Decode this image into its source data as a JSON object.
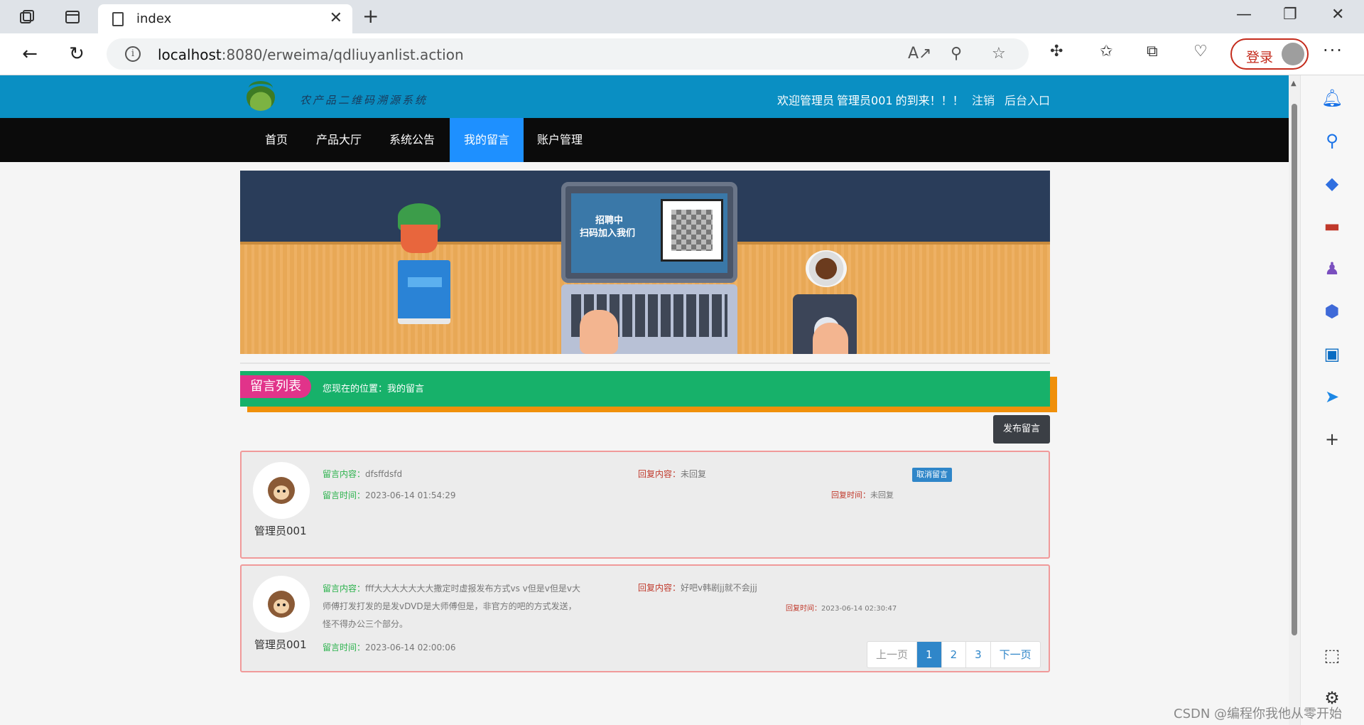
{
  "browser": {
    "tab_title": "index",
    "url_host": "localhost",
    "url_path": ":8080/erweima/qdliuyanlist.action",
    "login_label": "登录"
  },
  "site": {
    "name": "农产品二维码溯源系统",
    "welcome_prefix": "欢迎管理员",
    "username": "管理员001",
    "welcome_suffix": "的到来！！！",
    "logout": "注销",
    "backend": "后台入口"
  },
  "nav": {
    "items": [
      {
        "label": "首页"
      },
      {
        "label": "产品大厅"
      },
      {
        "label": "系统公告"
      },
      {
        "label": "我的留言"
      },
      {
        "label": "账户管理"
      }
    ]
  },
  "banner": {
    "line1": "招聘中",
    "line2": "扫码加入我们"
  },
  "section": {
    "title": "留言列表",
    "breadcrumb": "您现在的位置：我的留言"
  },
  "post_button": "发布留言",
  "messages": [
    {
      "user": "管理员001",
      "content_label": "留言内容：",
      "content": "dfsffdsfd",
      "time_label": "留言时间：",
      "time": "2023-06-14 01:54:29",
      "reply_label": "回复内容：",
      "reply": "未回复",
      "reply_time_label": "回复时间：",
      "reply_time": "未回复",
      "cancel": "取消留言"
    },
    {
      "user": "管理员001",
      "content_label": "留言内容：",
      "content_line1": "fff大大大大大大大撒定时虚报发布方式vs v但是v但是v大",
      "content_line2": "师傅打发打发的是发vDVD是大师傅但是，非官方的吧的方式发送，",
      "content_line3": "怪不得办公三个部分。",
      "time_label": "留言时间：",
      "time": "2023-06-14 02:00:06",
      "reply_label": "回复内容：",
      "reply": "好吧v韩剧jj就不会jjj",
      "reply_time_label": "回复时间：",
      "reply_time": "2023-06-14 02:30:47"
    }
  ],
  "pager": {
    "prev": "上一页",
    "pages": [
      "1",
      "2",
      "3"
    ],
    "current": "1",
    "next": "下一页"
  },
  "watermark": "CSDN @编程你我他从零开始"
}
